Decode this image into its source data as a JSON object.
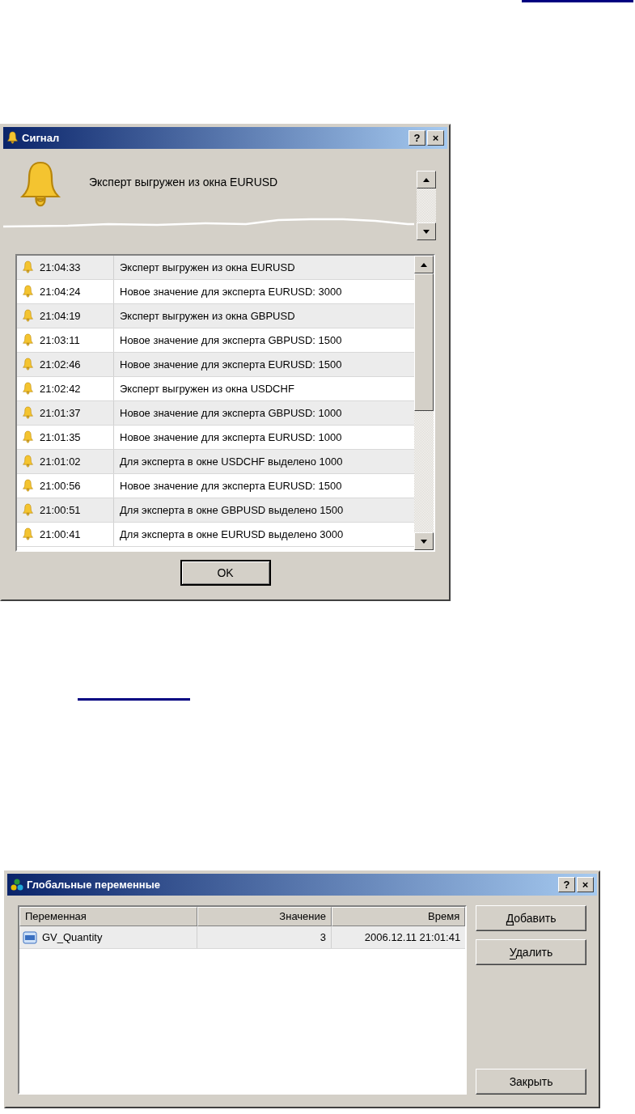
{
  "signal_dialog": {
    "title": "Сигнал",
    "title_buttons": [
      "?",
      "×"
    ],
    "message": "Эксперт выгружен из окна EURUSD",
    "rows": [
      {
        "time": "21:04:33",
        "message": "Эксперт выгружен из окна EURUSD"
      },
      {
        "time": "21:04:24",
        "message": "Новое значение для эксперта EURUSD: 3000"
      },
      {
        "time": "21:04:19",
        "message": "Эксперт выгружен из окна GBPUSD"
      },
      {
        "time": "21:03:11",
        "message": "Новое значение для эксперта GBPUSD: 1500"
      },
      {
        "time": "21:02:46",
        "message": "Новое значение для эксперта EURUSD: 1500"
      },
      {
        "time": "21:02:42",
        "message": "Эксперт выгружен из окна USDCHF"
      },
      {
        "time": "21:01:37",
        "message": "Новое значение для эксперта GBPUSD: 1000"
      },
      {
        "time": "21:01:35",
        "message": "Новое значение для эксперта EURUSD: 1000"
      },
      {
        "time": "21:01:02",
        "message": "Для эксперта в окне USDCHF выделено 1000"
      },
      {
        "time": "21:00:56",
        "message": "Новое значение для эксперта EURUSD: 1500"
      },
      {
        "time": "21:00:51",
        "message": "Для эксперта в окне GBPUSD выделено 1500"
      },
      {
        "time": "21:00:41",
        "message": "Для эксперта в окне EURUSD выделено 3000"
      }
    ],
    "ok_button": "OK"
  },
  "globals_dialog": {
    "title": "Глобальные переменные",
    "title_buttons": [
      "?",
      "×"
    ],
    "columns": [
      "Переменная",
      "Значение",
      "Время"
    ],
    "rows": [
      {
        "name": "GV_Quantity",
        "value": "3",
        "time": "2006.12.11 21:01:41"
      }
    ],
    "buttons": [
      {
        "label": "Добавить",
        "mnemonic": true
      },
      {
        "label": "Удалить",
        "mnemonic": true
      },
      {
        "label": "Закрыть",
        "mnemonic": false
      }
    ]
  }
}
